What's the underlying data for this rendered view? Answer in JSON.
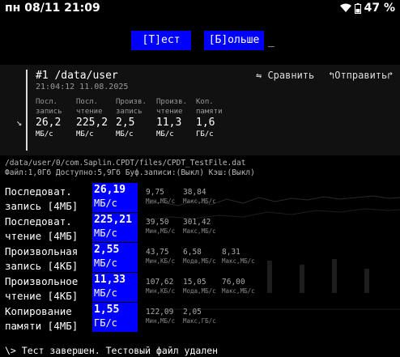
{
  "statusbar": {
    "datetime": "пн 08/11 21:09",
    "battery": "47 %"
  },
  "buttons": {
    "test": "[Т]ест",
    "more": "[Б]ольше",
    "cursor": "_"
  },
  "panel": {
    "title": "#1 /data/user",
    "datetime": "21:04:12 11.08.2025",
    "compare": "⇋ Сравнить",
    "send": "↰Отправить↱",
    "columns": [
      {
        "h1": "Посл.",
        "h2": "запись",
        "value": "26,2",
        "unit": "МБ/с"
      },
      {
        "h1": "Посл.",
        "h2": "чтение",
        "value": "225,2",
        "unit": "МБ/с"
      },
      {
        "h1": "Произв.",
        "h2": "запись",
        "value": "2,5",
        "unit": "МБ/с"
      },
      {
        "h1": "Произв.",
        "h2": "чтение",
        "value": "11,3",
        "unit": "МБ/с"
      },
      {
        "h1": "Коп.",
        "h2": "памяти",
        "value": "1,6",
        "unit": "ГБ/с"
      }
    ]
  },
  "fileinfo": {
    "path": "/data/user/0/com.Saplin.CPDT/files/CPDT_TestFile.dat",
    "details": "Файл:1,0Гб Доступно:5,9Гб Буф.записи:(Выкл) Кэш:(Выкл)"
  },
  "results": [
    {
      "l1": "Последоват.",
      "l2": "запись [4МБ]",
      "value": "26,19",
      "unit": "МБ/с",
      "stats": [
        {
          "v": "9,75",
          "l": "Мин,МБ/с"
        },
        {
          "v": "38,84",
          "l": "Макс,МБ/с"
        }
      ]
    },
    {
      "l1": "Последоват.",
      "l2": "чтение [4МБ]",
      "value": "225,21",
      "unit": "МБ/с",
      "stats": [
        {
          "v": "39,50",
          "l": "Мин,МБ/с"
        },
        {
          "v": "301,42",
          "l": "Макс,МБ/с"
        }
      ]
    },
    {
      "l1": "Произвольная",
      "l2": "запись [4КБ]",
      "value": "2,55",
      "unit": "МБ/с",
      "stats": [
        {
          "v": "43,75",
          "l": "Мин,КБ/с"
        },
        {
          "v": "6,58",
          "l": "Мода,МБ/с"
        },
        {
          "v": "8,31",
          "l": "Макс,МБ/с"
        }
      ]
    },
    {
      "l1": "Произвольное",
      "l2": "чтение [4КБ]",
      "value": "11,33",
      "unit": "МБ/с",
      "stats": [
        {
          "v": "107,62",
          "l": "Мин,КБ/с"
        },
        {
          "v": "15,05",
          "l": "Мода,МБ/с"
        },
        {
          "v": "76,00",
          "l": "Макс,МБ/с"
        }
      ]
    },
    {
      "l1": "Копирование",
      "l2": "памяти [4МБ]",
      "value": "1,55",
      "unit": "ГБ/с",
      "stats": [
        {
          "v": "122,09",
          "l": "Мин,МБ/с"
        },
        {
          "v": "2,05",
          "l": "Макс,ГБ/с"
        }
      ]
    }
  ],
  "footer": "\\> Тест завершен. Тестовый файл удален"
}
